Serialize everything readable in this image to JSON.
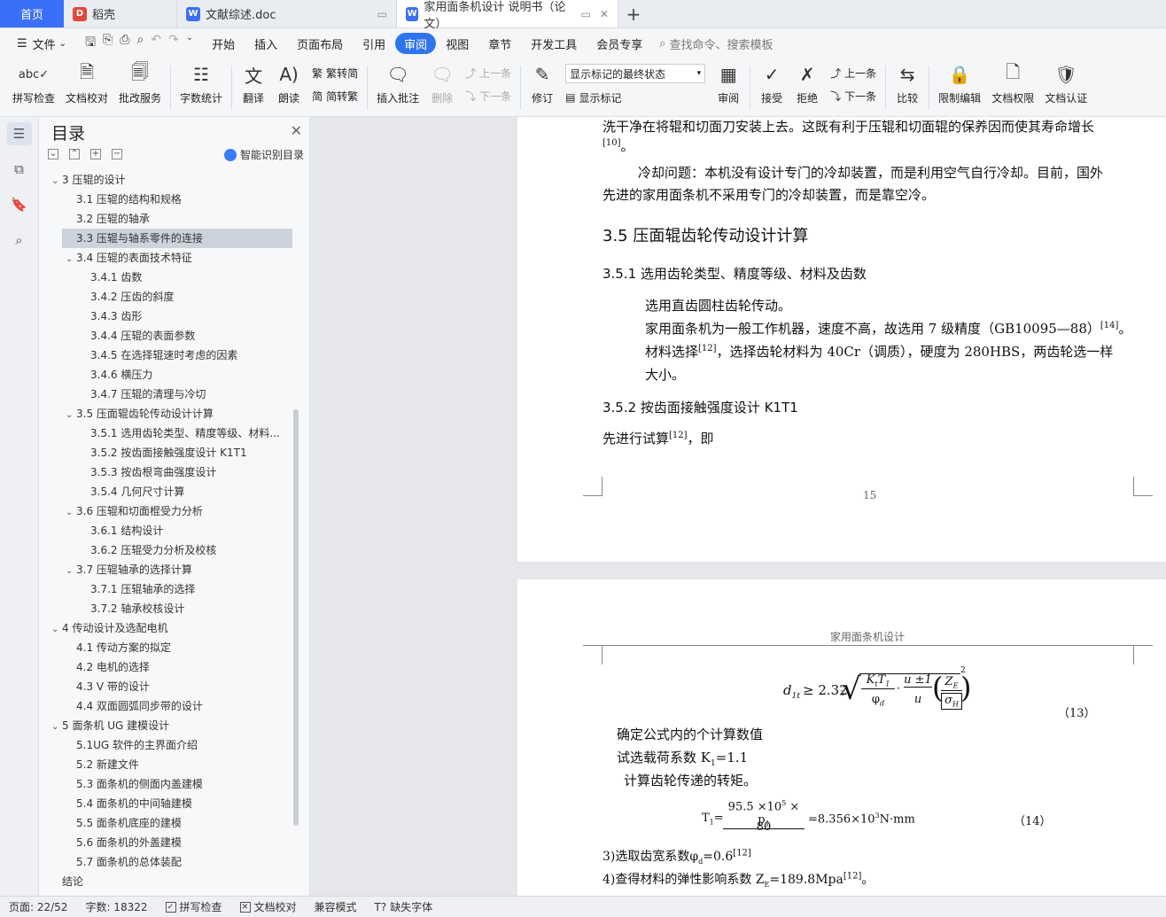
{
  "tabs": {
    "home": "首页",
    "items": [
      {
        "label": "稻壳",
        "icon": "daoke-icon",
        "color": "#e04a3b"
      },
      {
        "label": "文献综述.doc",
        "icon": "word-icon",
        "color": "#3a6ff7"
      },
      {
        "label": "家用面条机设计 说明书（论文）",
        "icon": "word-icon",
        "color": "#3a6ff7"
      }
    ],
    "add": "+"
  },
  "menu": {
    "file": "文件",
    "items": [
      "开始",
      "插入",
      "页面布局",
      "引用",
      "审阅",
      "视图",
      "章节",
      "开发工具",
      "会员专享"
    ],
    "active": "审阅",
    "search": "查找命令、搜索模板"
  },
  "ribbon": {
    "spell": "拼写检查",
    "proof": "文档校对",
    "annot_service": "批改服务",
    "word_count": "字数统计",
    "translate": "翻译",
    "read": "朗读",
    "to_trad": "繁转简",
    "to_simp": "简转繁",
    "insert_comment": "插入批注",
    "delete": "删除",
    "prev": "上一条",
    "next": "下一条",
    "revise": "修订",
    "markup_select": "显示标记的最终状态",
    "show_markup": "显示标记",
    "review": "审阅",
    "accept": "接受",
    "reject": "拒绝",
    "prev2": "上一条",
    "next2": "下一条",
    "compare": "比较",
    "restrict": "限制编辑",
    "permission": "文档权限",
    "certify": "文档认证"
  },
  "toc": {
    "title": "目录",
    "smart": "智能识别目录",
    "selected_index": 3,
    "items": [
      {
        "level": 1,
        "caret": "⌄",
        "text": "3  压辊的设计"
      },
      {
        "level": 2,
        "caret": "",
        "text": "3.1 压辊的结构和规格"
      },
      {
        "level": 2,
        "caret": "",
        "text": "3.2 压辊的轴承"
      },
      {
        "level": 2,
        "caret": "",
        "text": "3.3 压辊与轴系零件的连接"
      },
      {
        "level": 2,
        "caret": "⌄",
        "text": "3.4 压辊的表面技术特征"
      },
      {
        "level": 3,
        "caret": "",
        "text": "3.4.1 齿数"
      },
      {
        "level": 3,
        "caret": "",
        "text": "3.4.2 压齿的斜度"
      },
      {
        "level": 3,
        "caret": "",
        "text": "3.4.3 齿形"
      },
      {
        "level": 3,
        "caret": "",
        "text": "3.4.4 压辊的表面参数"
      },
      {
        "level": 3,
        "caret": "",
        "text": "3.4.5 在选择辊速时考虑的因素"
      },
      {
        "level": 3,
        "caret": "",
        "text": "3.4.6 横压力"
      },
      {
        "level": 3,
        "caret": "",
        "text": "3.4.7 压辊的清理与冷切"
      },
      {
        "level": 2,
        "caret": "⌄",
        "text": "3.5 压面辊齿轮传动设计计算"
      },
      {
        "level": 3,
        "caret": "",
        "text": "3.5.1 选用齿轮类型、精度等级、材料..."
      },
      {
        "level": 3,
        "caret": "",
        "text": "3.5.2 按齿面接触强度设计 K1T1"
      },
      {
        "level": 3,
        "caret": "",
        "text": "3.5.3 按齿根弯曲强度设计"
      },
      {
        "level": 3,
        "caret": "",
        "text": "3.5.4 几何尺寸计算"
      },
      {
        "level": 2,
        "caret": "⌄",
        "text": "3.6 压辊和切面棍受力分析"
      },
      {
        "level": 3,
        "caret": "",
        "text": "3.6.1 结构设计"
      },
      {
        "level": 3,
        "caret": "",
        "text": "3.6.2 压辊受力分析及校核"
      },
      {
        "level": 2,
        "caret": "⌄",
        "text": "3.7 压辊轴承的选择计算"
      },
      {
        "level": 3,
        "caret": "",
        "text": "3.7.1 压辊轴承的选择"
      },
      {
        "level": 3,
        "caret": "",
        "text": "3.7.2 轴承校核设计"
      },
      {
        "level": 1,
        "caret": "⌄",
        "text": "4 传动设计及选配电机"
      },
      {
        "level": 2,
        "caret": "",
        "text": "4.1 传动方案的拟定"
      },
      {
        "level": 2,
        "caret": "",
        "text": "4.2 电机的选择"
      },
      {
        "level": 2,
        "caret": "",
        "text": "4.3 V 带的设计"
      },
      {
        "level": 2,
        "caret": "",
        "text": "4.4 双面圆弧同步带的设计"
      },
      {
        "level": 1,
        "caret": "⌄",
        "text": "5  面条机 UG 建模设计"
      },
      {
        "level": 2,
        "caret": "",
        "text": "5.1UG 软件的主界面介绍"
      },
      {
        "level": 2,
        "caret": "",
        "text": "5.2 新建文件"
      },
      {
        "level": 2,
        "caret": "",
        "text": "5.3 面条机的侧面内盖建模"
      },
      {
        "level": 2,
        "caret": "",
        "text": "5.4 面条机的中间轴建模"
      },
      {
        "level": 2,
        "caret": "",
        "text": "5.5 面条机底座的建模"
      },
      {
        "level": 2,
        "caret": "",
        "text": "5.6 面条机的外盖建模"
      },
      {
        "level": 2,
        "caret": "",
        "text": "5.7 面条机的总体装配"
      },
      {
        "level": 1,
        "caret": "",
        "text": "结论"
      }
    ]
  },
  "page1": {
    "l1": "洗干净在将辊和切面刀安装上去。这既有利于压辊和切面辊的保养因而使其寿命增长",
    "l1_ref": "[10]",
    "l1b": "。",
    "l2": "冷却问题：本机没有设计专门的冷却装置，而是利用空气自行冷却。目前，国外",
    "l3": "先进的家用面条机不采用专门的冷却装置，而是靠空冷。",
    "h_35": "3.5 压面辊齿轮传动设计计算",
    "h_351": "3.5.1 选用齿轮类型、精度等级、材料及齿数",
    "l4": "选用直齿圆柱齿轮传动。",
    "l5": "家用面条机为一般工作机器，速度不高，故选用 7 级精度（GB10095—88）",
    "l5_ref": "[14]",
    "l5b": "。",
    "l6a": "材料选择",
    "l6_ref": "[12]",
    "l6b": "，选择齿轮材料为 40Cr（调质），硬度为 280HBS，两齿轮选一样",
    "l7": "大小。",
    "h_352": "3.5.2 按齿面接触强度设计 K1T1",
    "l8a": "先进行试算",
    "l8_ref": "[12]",
    "l8b": "，即",
    "page_no": "15"
  },
  "page2": {
    "header": "家用面条机设计",
    "f13_lhs": "d",
    "f13_sub": "1t",
    "f13_mid": "≥ 2.32",
    "f13_root": "3",
    "f13_frac1_num": "K",
    "f13_frac1_num_sub": "t",
    "f13_frac1_num2": "T",
    "f13_frac1_num2_sub": "1",
    "f13_frac1_den": "φ",
    "f13_frac1_den_sub": "d",
    "f13_dot": "·",
    "f13_frac2_num": "u ±1",
    "f13_frac2_den": "u",
    "f13_frac3_num": "Z",
    "f13_frac3_num_sub": "E",
    "f13_frac3_den": "σ",
    "f13_frac3_den_sub": "H",
    "f13_sq": "2",
    "f13_no": "（13）",
    "l1": "确定公式内的个计算数值",
    "l2a": "试选载荷系数 K",
    "l2_sub": "1",
    "l2b": "=1.1",
    "l3": "计算齿轮传递的转矩。",
    "f14_lhs": "T",
    "f14_lhs_sub": "1",
    "f14_eq": "=",
    "f14_num_a": "95.5 ×10",
    "f14_num_exp": "5",
    "f14_num_b": " × p",
    "f14_num_sub": "1",
    "f14_den": "80",
    "f14_rhs_a": "=8.356×10",
    "f14_rhs_exp": "3",
    "f14_rhs_b": "N·mm",
    "f14_no": "（14）",
    "l4a": "3)选取齿宽系数φ",
    "l4_sub": "d",
    "l4b": "=0.6",
    "l4_ref": "[12]",
    "l5a": "4)查得材料的弹性影响系数 Z",
    "l5_sub": "E",
    "l5b": "=189.8Mpa",
    "l5_ref": "[12]",
    "l5c": "。"
  },
  "status": {
    "page": "页面: 22/52",
    "words": "字数: 18322",
    "spell": "拼写检查",
    "proof": "文档校对",
    "compat": "兼容模式",
    "missing_font": "缺失字体"
  }
}
